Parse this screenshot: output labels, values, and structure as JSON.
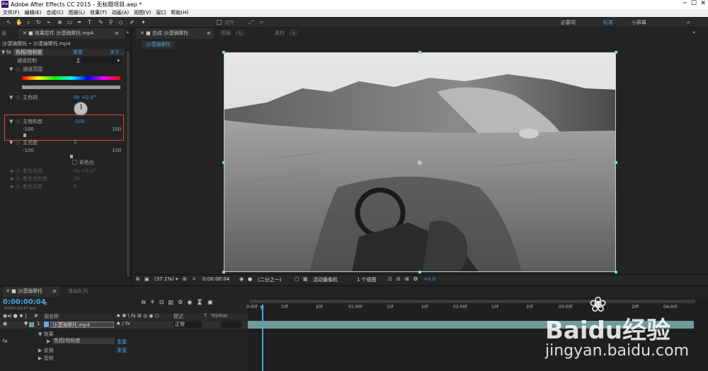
{
  "title_bar": {
    "title": "Adobe After Effects CC 2015 - 无标题项目.aep *",
    "logo": "Ae"
  },
  "menu": [
    "文件(F)",
    "编辑(E)",
    "合成(C)",
    "图层(L)",
    "效果(T)",
    "动画(A)",
    "视图(V)",
    "窗口",
    "帮助(H)"
  ],
  "toolbar": {
    "snap_label": "对齐",
    "workspaces": [
      "必要项",
      "标准",
      "小屏幕"
    ],
    "active_workspace": "标准"
  },
  "effects_panel": {
    "panel_prefix": "组",
    "tab_label": "效果控件 沙漠骑摩托.mp4",
    "breadcrumb": "沙漠骑摩托 • 沙漠骑摩托.mp4",
    "fx_label": "fx",
    "effect_name": "色相/饱和度",
    "reset": "重置",
    "about": "关于...",
    "channel_control_label": "通道控制",
    "channel_control_value": "主",
    "channel_range_label": "通道范围",
    "master_hue_label": "主色相",
    "master_hue_value": "0x +0.0°",
    "master_saturation_label": "主饱和度",
    "master_saturation_value": "-100",
    "sat_min": "-100",
    "sat_max": "100",
    "sat_level": 0,
    "master_lightness_label": "主亮度",
    "master_lightness_value": "0",
    "light_min": "-100",
    "light_max": "100",
    "light_level": 0.5,
    "colorize_label": "彩色化",
    "colorize_hue_label": "着色色相",
    "colorize_hue_value": "0x +0.0°",
    "colorize_sat_label": "着色饱和度",
    "colorize_sat_value": "25",
    "colorize_light_label": "着色亮度",
    "colorize_light_value": "0"
  },
  "viewer": {
    "tab_comp": "合成 沙漠骑摩托",
    "tab_layer": "图层 （无）",
    "tab_footage": "素材 （无）",
    "comp_chip": "沙漠骑摩托",
    "zoom": "(37.1%)",
    "timecode": "0:00:00:04",
    "resolution": "(二分之一)",
    "camera": "活动摄像机",
    "views": "1 个视图",
    "exposure": "+0.0"
  },
  "timeline": {
    "tab_label": "沙漠骑摩托",
    "render_queue": "渲染队列",
    "timecode": "0:00:00:04",
    "fps": "00004 (29.97 fps)",
    "search_placeholder": "ρ.",
    "col_source": "源名称",
    "col_mode": "模式",
    "col_t": "T",
    "col_trkmat": "TrkMat",
    "layer_number": "1",
    "layer_name": "沙漠骑摩托.mp4",
    "layer_mode": "正常",
    "effects_label": "效果",
    "effect_row": "色相/饱和度",
    "effect_reset": "重置",
    "transform_label": "变换",
    "transform_reset": "重置",
    "audio_label": "音频",
    "ruler": [
      "0:00f",
      "10f",
      "20f",
      "01:00f",
      "10f",
      "20f",
      "02:00f",
      "10f",
      "20f",
      "03:00f",
      "10f",
      "20f",
      "04:00f"
    ]
  },
  "watermark": {
    "brand": "Baidu经验",
    "url": "jingyan.baidu.com"
  },
  "colors": {
    "accent": "#4aa3e0",
    "highlight_box": "#e0452f",
    "layer_bar": "#6f9c97"
  }
}
